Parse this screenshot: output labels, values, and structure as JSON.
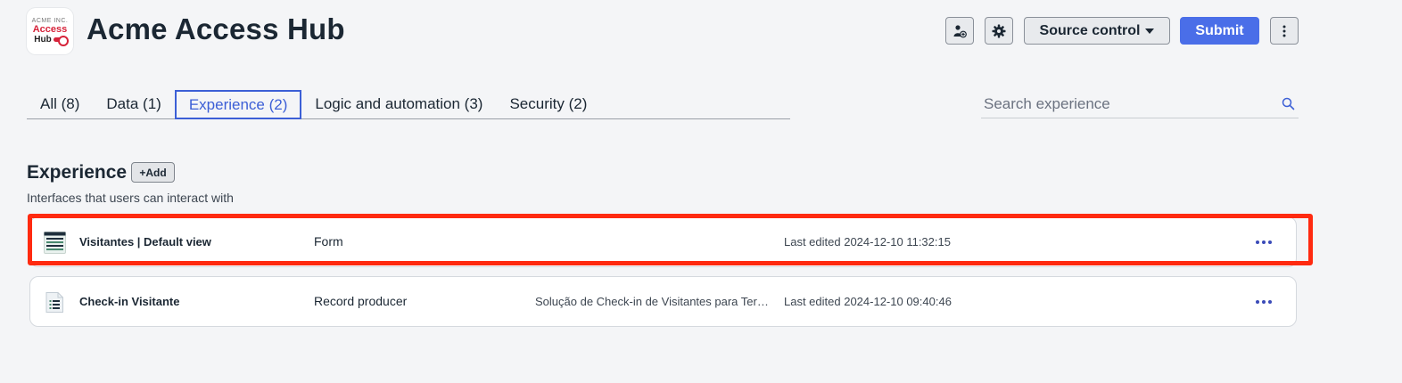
{
  "app": {
    "logo_line1": "ACME INC.",
    "logo_line2": "Access",
    "logo_line3": "Hub",
    "title": "Acme Access Hub"
  },
  "header": {
    "share_icon": "user-share-icon",
    "settings_icon": "gear-icon",
    "source_control_label": "Source control",
    "submit_label": "Submit",
    "more_icon": "vertical-ellipsis-icon",
    "accent_color": "#4a6ee8"
  },
  "tabs": [
    {
      "label": "All (8)",
      "active": false
    },
    {
      "label": "Data (1)",
      "active": false
    },
    {
      "label": "Experience (2)",
      "active": true
    },
    {
      "label": "Logic and automation (3)",
      "active": false
    },
    {
      "label": "Security (2)",
      "active": false
    }
  ],
  "search": {
    "placeholder": "Search experience",
    "value": "",
    "icon": "search-icon"
  },
  "section": {
    "title": "Experience",
    "add_label": "+Add",
    "description": "Interfaces that users can interact with"
  },
  "items": [
    {
      "icon": "table-view-icon",
      "name": "Visitantes | Default view",
      "type": "Form",
      "description": "",
      "last_edited": "Last edited 2024-12-10 11:32:15",
      "highlighted": true
    },
    {
      "icon": "record-producer-icon",
      "name": "Check-in Visitante",
      "type": "Record producer",
      "description": "Solução de Check-in de Visitantes para Termi...",
      "last_edited": "Last edited 2024-12-10 09:40:46",
      "highlighted": false
    }
  ],
  "highlight_color": "#ff2a10"
}
